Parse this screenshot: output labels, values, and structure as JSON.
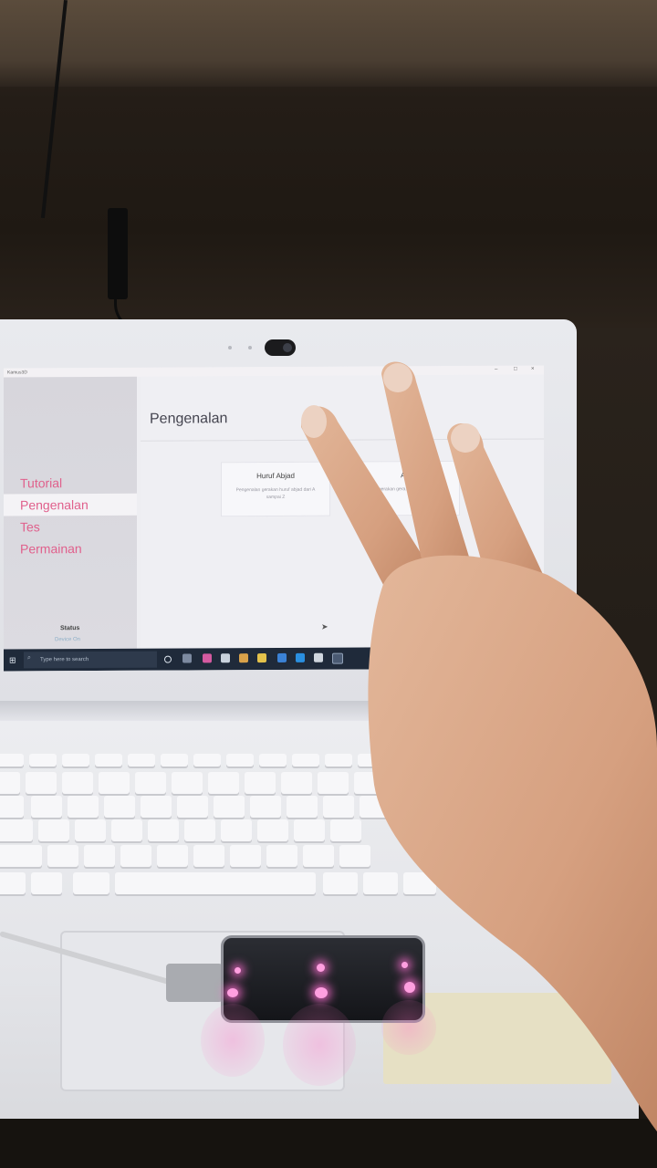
{
  "app": {
    "window_title": "Kamus3D",
    "page_title": "Pengenalan",
    "nav": [
      {
        "label": "Tutorial",
        "active": false
      },
      {
        "label": "Pengenalan",
        "active": true
      },
      {
        "label": "Tes",
        "active": false
      },
      {
        "label": "Permainan",
        "active": false
      }
    ],
    "status": {
      "label": "Status",
      "value": "Device On"
    },
    "cards": [
      {
        "title": "Huruf Abjad",
        "desc": "Pengenalan gerakan huruf abjad dari A sampai Z"
      },
      {
        "title": "An",
        "desc": "gerakan gera... 1 sampa..."
      }
    ]
  },
  "taskbar": {
    "search_placeholder": "Type here to search"
  },
  "colors": {
    "accent": "#e0608c",
    "sidebar": "#d7d6dc",
    "taskbar": "#1f2a3a",
    "led": "#ff9fe0"
  }
}
